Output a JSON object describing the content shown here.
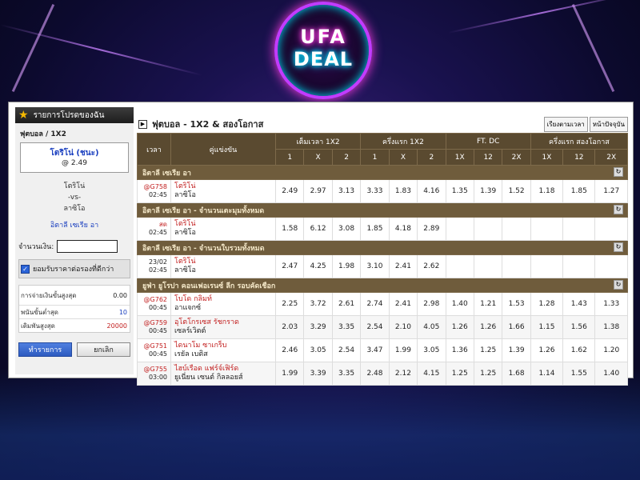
{
  "logo": {
    "line1": "UFA",
    "line2": "DEAL"
  },
  "slip": {
    "header": "รายการโปรดของฉัน",
    "bet_type": "ฟุตบอล / 1X2",
    "selection": "โตริโน่ (ชนะ)",
    "odds": "@ 2.49",
    "home": "โตริโน่",
    "vs": "-vs-",
    "away": "ลาซิโอ",
    "league": "อิตาลี เซเรีย อา",
    "amount_label": "จำนวนเงิน:",
    "amount_value": "",
    "accept_label": "ยอมรับราคาต่อรองที่ดีกว่า",
    "max_payout_label": "การจ่ายเงินขั้นสูงสุด",
    "max_payout_value": "0.00",
    "min_bet_label": "พนันขั้นต่ำสุด",
    "min_bet_value": "10",
    "max_bet_label": "เดิมพันสูงสุด",
    "max_bet_value": "20000",
    "confirm_label": "ทำรายการ",
    "cancel_label": "ยกเลิก"
  },
  "board": {
    "title": "ฟุตบอล - 1X2 & สองโอกาส",
    "sort_time": "เรียงตามเวลา",
    "sort_current": "หน้าปัจจุบัน",
    "columns": {
      "time": "เวลา",
      "match": "คู่แข่งขัน",
      "ft_1x2": "เต็มเวลา 1X2",
      "fh_1x2": "ครึ่งแรก 1X2",
      "ft_dc": "FT. DC",
      "fh_dc": "ครึ่งแรก สองโอกาส"
    },
    "subcols": [
      "1",
      "X",
      "2",
      "1",
      "X",
      "2",
      "1X",
      "12",
      "2X",
      "1X",
      "12",
      "2X"
    ],
    "refresh": "↻",
    "sections": [
      {
        "league": "อิตาลี เซเรีย อา",
        "matches": [
          {
            "code": "@G758",
            "time": "02:45",
            "home": "โตริโน่",
            "away": "ลาซิโอ",
            "odds": [
              "2.49",
              "2.97",
              "3.13",
              "3.33",
              "1.83",
              "4.16",
              "1.35",
              "1.39",
              "1.52",
              "1.18",
              "1.85",
              "1.27"
            ]
          }
        ]
      },
      {
        "league": "อิตาลี เซเรีย อา - จำนวนเตะมุมทั้งหมด",
        "matches": [
          {
            "code": "สด",
            "time": "02:45",
            "home": "โตริโน่",
            "away": "ลาซิโอ",
            "odds": [
              "1.58",
              "6.12",
              "3.08",
              "1.85",
              "4.18",
              "2.89",
              "",
              "",
              "",
              "",
              "",
              ""
            ]
          }
        ]
      },
      {
        "league": "อิตาลี เซเรีย อา - จำนวนใบรวมทั้งหมด",
        "matches": [
          {
            "code": "23/02",
            "time": "02:45",
            "home": "โตริโน่",
            "away": "ลาซิโอ",
            "odds": [
              "2.47",
              "4.25",
              "1.98",
              "3.10",
              "2.41",
              "2.62",
              "",
              "",
              "",
              "",
              "",
              ""
            ]
          }
        ]
      },
      {
        "league": "ยูฟ่า ยูโรปา คอนเฟอเรนซ์ ลีก รอบคัดเชือก",
        "matches": [
          {
            "code": "@G762",
            "time": "00:45",
            "home": "โบโด กลิมท์",
            "away": "อาแจกซ์",
            "odds": [
              "2.25",
              "3.72",
              "2.61",
              "2.74",
              "2.41",
              "2.98",
              "1.40",
              "1.21",
              "1.53",
              "1.28",
              "1.43",
              "1.33"
            ]
          },
          {
            "code": "@G759",
            "time": "00:45",
            "home": "อุโตโกรเซส รัชกราด",
            "away": "เซลร์เวิตต์",
            "odds": [
              "2.03",
              "3.29",
              "3.35",
              "2.54",
              "2.10",
              "4.05",
              "1.26",
              "1.26",
              "1.66",
              "1.15",
              "1.56",
              "1.38"
            ]
          },
          {
            "code": "@G751",
            "time": "00:45",
            "home": "ไดนาโม ซาเกร็บ",
            "away": "เรยัล เบติส",
            "odds": [
              "2.46",
              "3.05",
              "2.54",
              "3.47",
              "1.99",
              "3.05",
              "1.36",
              "1.25",
              "1.39",
              "1.26",
              "1.62",
              "1.20"
            ]
          },
          {
            "code": "@G755",
            "time": "03:00",
            "home": "ไฮบ์เรือด แฟร์จ์เฟิร์ด",
            "away": "ยูเนี่ยน เซนต์ กิลลอยส์",
            "odds": [
              "1.99",
              "3.39",
              "3.35",
              "2.48",
              "2.12",
              "4.15",
              "1.25",
              "1.25",
              "1.68",
              "1.14",
              "1.55",
              "1.40"
            ]
          }
        ]
      }
    ]
  }
}
